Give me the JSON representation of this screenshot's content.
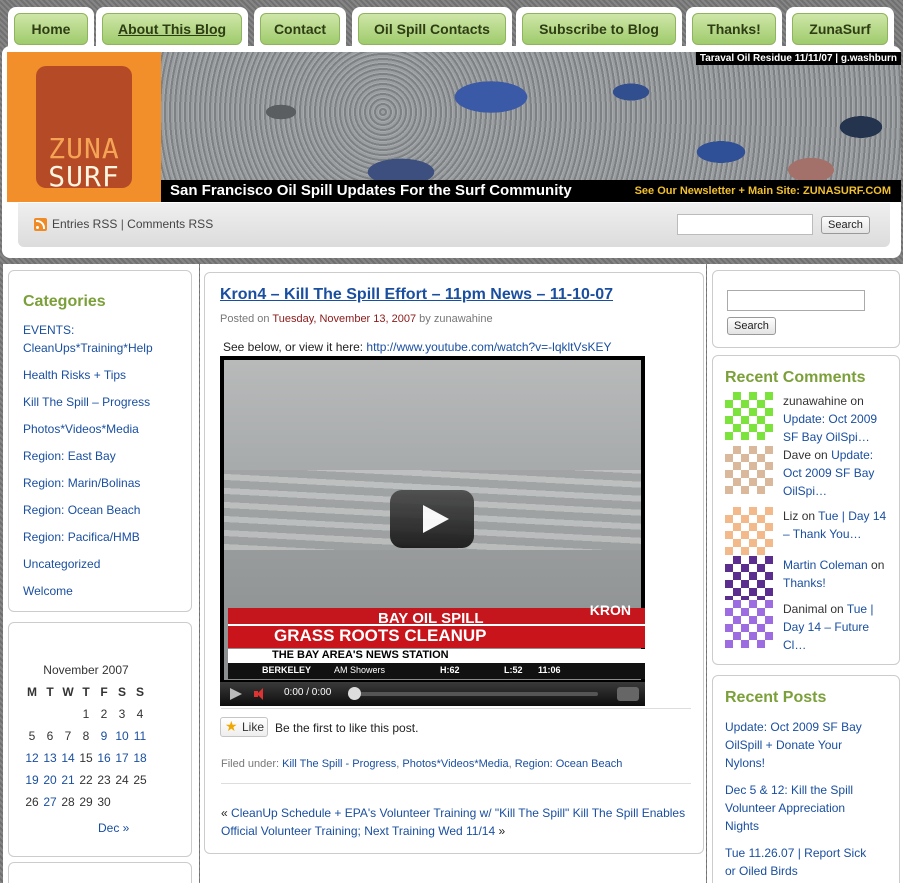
{
  "nav": {
    "tabs": [
      {
        "label": "Home"
      },
      {
        "label": "About This Blog"
      },
      {
        "label": "Contact"
      },
      {
        "label": "Oil Spill Contacts"
      },
      {
        "label": "Subscribe to Blog"
      },
      {
        "label": "Thanks!"
      },
      {
        "label": "ZunaSurf"
      }
    ]
  },
  "logo": {
    "line1": "ZUNA",
    "line2": "SURF"
  },
  "banner": {
    "credit": "Taraval Oil Residue 11/11/07 | g.washburn",
    "title": "San Francisco Oil Spill Updates For the Surf Community",
    "newsletter": "See Our Newsletter + Main Site:  ZUNASURF.COM"
  },
  "rss": {
    "entries": "Entries RSS",
    "separator": "|",
    "comments": "Comments RSS"
  },
  "search": {
    "button": "Search"
  },
  "sidebar_left": {
    "categories_title": "Categories",
    "categories": [
      "EVENTS: CleanUps*Training*Help",
      "Health Risks + Tips",
      "Kill The Spill – Progress",
      "Photos*Videos*Media",
      "Region: East Bay",
      "Region: Marin/Bolinas",
      "Region: Ocean Beach",
      "Region: Pacifica/HMB",
      "Uncategorized",
      "Welcome"
    ],
    "calendar": {
      "caption": "November 2007",
      "days": [
        "M",
        "T",
        "W",
        "T",
        "F",
        "S",
        "S"
      ],
      "weeks": [
        [
          "",
          "",
          "",
          "1",
          "2",
          "3",
          "4"
        ],
        [
          "5",
          "6",
          "7",
          "8",
          "9",
          "10",
          "11"
        ],
        [
          "12",
          "13",
          "14",
          "15",
          "16",
          "17",
          "18"
        ],
        [
          "19",
          "20",
          "21",
          "22",
          "23",
          "24",
          "25"
        ],
        [
          "26",
          "27",
          "28",
          "29",
          "30",
          "",
          ""
        ]
      ],
      "linked": [
        "9",
        "10",
        "11",
        "12",
        "13",
        "14",
        "16",
        "17",
        "18",
        "19",
        "20",
        "21",
        "27"
      ],
      "prev": "Dec »"
    }
  },
  "post": {
    "title": "Kron4 – Kill The Spill Effort – 11pm News – 11-10-07",
    "posted_on": "Posted on",
    "date": "Tuesday, November 13, 2007",
    "by": "by",
    "author": "zunawahine",
    "intro": "See below, or view it here:",
    "link": "http://www.youtube.com/watch?v=-lqkltVsKEY",
    "video": {
      "l1": "BAY OIL SPILL",
      "l2": "GRASS ROOTS CLEANUP",
      "l3": "THE BAY AREA'S NEWS STATION",
      "city": "BERKELEY",
      "forecast": "AM Showers",
      "hi": "H:62",
      "lo": "L:52",
      "clock": "11:06",
      "station": "KRON",
      "time": "0:00 / 0:00"
    },
    "like_label": "Like",
    "like_text": "Be the first to like this post.",
    "filed_under": "Filed under:",
    "filed_cats": [
      "Kill The Spill - Progress",
      "Photos*Videos*Media",
      "Region: Ocean Beach"
    ],
    "prev_arrow": "«",
    "prev_link": "CleanUp Schedule + EPA's Volunteer Training w/ \"Kill The Spill\"",
    "next_link": "Kill The Spill Enables Official Volunteer Training; Next Training Wed 11/14",
    "next_arrow": "»"
  },
  "sidebar_right": {
    "search_button": "Search",
    "recent_comments_title": "Recent Comments",
    "comments": [
      {
        "author": "zunawahine",
        "on": "on",
        "post": "Update: Oct 2009 SF Bay OilSpi…",
        "author_link": false
      },
      {
        "author": "Dave",
        "on": "on",
        "post": "Update: Oct 2009 SF Bay OilSpi…",
        "author_link": false
      },
      {
        "author": "Liz",
        "on": "on",
        "post": "Tue | Day 14 – Thank You…",
        "author_link": false
      },
      {
        "author": "Martin Coleman",
        "on": "on",
        "post": "Thanks!",
        "author_link": true
      },
      {
        "author": "Danimal",
        "on": "on",
        "post": "Tue | Day 14 – Future Cl…",
        "author_link": false
      }
    ],
    "recent_posts_title": "Recent Posts",
    "posts": [
      "Update: Oct 2009 SF Bay OilSpill + Donate Your Nylons!",
      "Dec 5 & 12: Kill the Spill Volunteer Appreciation Nights",
      "Tue 11.26.07 | Report Sick or Oiled Birds"
    ]
  },
  "colors": {
    "accent_green": "#7ba03a",
    "link_blue": "#1a4fa0",
    "logo_orange": "#f28f2a",
    "date_red": "#8b1a1a"
  }
}
